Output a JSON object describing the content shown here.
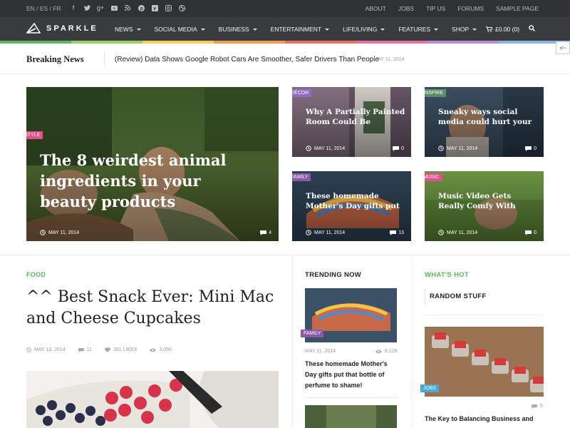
{
  "topbar": {
    "languages": "EN / ES / FR",
    "social_icons": [
      "facebook-icon",
      "twitter-icon",
      "googleplus-icon",
      "youtube-icon",
      "rss-icon",
      "pinterest-icon",
      "vimeo-icon",
      "instagram-icon",
      "dribbble-icon"
    ],
    "links": [
      "ABOUT",
      "JOBS",
      "TIP US",
      "FORUMS",
      "SAMPLE PAGE"
    ]
  },
  "nav": {
    "brand": "SPARKLE",
    "items": [
      "NEWS",
      "SOCIAL MEDIA",
      "BUSINESS",
      "ENTERTAINMENT",
      "LIFE/LIVING",
      "FEATURES",
      "SHOP"
    ],
    "cart": "£0.00 (0)"
  },
  "rainbow": [
    "#5cb85c",
    "#9ad06a",
    "#f7d154",
    "#f39c4b",
    "#ef6b5a",
    "#e46fa3",
    "#b58bd3",
    "#8bb3e0"
  ],
  "breaking": {
    "label": "Breaking News",
    "headline": "(Review) Data Shows Google Robot Cars Are Smoother, Safer Drivers Than People",
    "date": "- MAY 11, 2014",
    "tab": "<~"
  },
  "featured": {
    "main": {
      "category": "STYLE",
      "title": "The 8 weirdest animal ingredients in your beauty products",
      "date": "MAY 11, 2014",
      "comments": "4"
    },
    "tiles": [
      {
        "category": "DÉCOR",
        "title": "Why A Partially Painted Room Could Be",
        "date": "MAY 11, 2014",
        "comments": "0"
      },
      {
        "category": "INSPIRE",
        "title": "Sneaky ways social media could hurt your",
        "date": "MAY 11, 2014",
        "comments": "0"
      },
      {
        "category": "FAMILY",
        "title": "These homemade Mother's Day gifts put",
        "date": "MAY 11, 2014",
        "comments": "13"
      },
      {
        "category": "MUSIC",
        "title": "Music Video Gets Really Comfy With",
        "date": "MAY 11, 2014",
        "comments": "0"
      }
    ]
  },
  "article": {
    "category": "FOOD",
    "title": "^^ Best Snack Ever: Mini Mac and Cheese Cupcakes",
    "date": "MAY 13, 2014",
    "comments": "11",
    "likes": "281 LIKES",
    "views": "3,056"
  },
  "trending": {
    "heading": "TRENDING NOW",
    "item": {
      "category": "FAMILY",
      "date": "MAY 11, 2014",
      "views": "8,129",
      "title": "These homemade Mother's Day gifts put that bottle of perfume to shame!"
    }
  },
  "whatshot": {
    "heading": "WHAT'S HOT",
    "subheading": "RANDOM STUFF",
    "item": {
      "category": "JOBS",
      "comments": "5",
      "title": "The Key to Balancing Business and"
    }
  }
}
